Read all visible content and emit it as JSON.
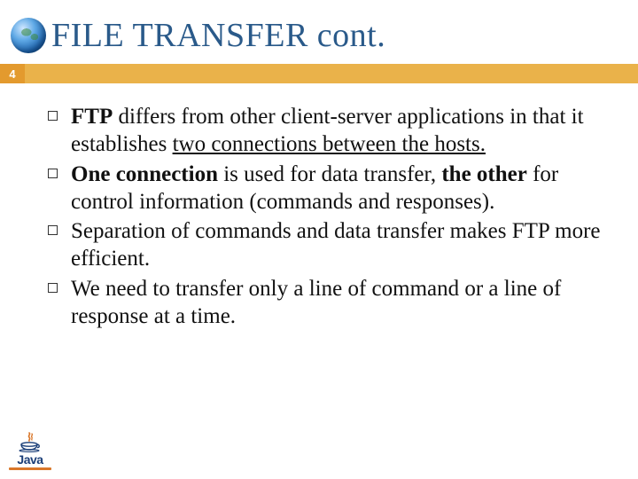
{
  "slide": {
    "title": "FILE TRANSFER cont.",
    "page_number": "4",
    "bullets": [
      {
        "prefix_bold": "FTP",
        "mid": " differs from other client-server applications in that it establishes ",
        "underlined": "two connections between the hosts.",
        "suffix": ""
      },
      {
        "prefix_bold": "One connection",
        "mid": " is used for data transfer, ",
        "bold2": "the other",
        "suffix": " for control information (commands and responses)."
      },
      {
        "text": "Separation of commands and data transfer makes FTP more efficient."
      },
      {
        "text": "We need to transfer only a line of command or a line of response at a time."
      }
    ],
    "logo_text": "Java"
  }
}
